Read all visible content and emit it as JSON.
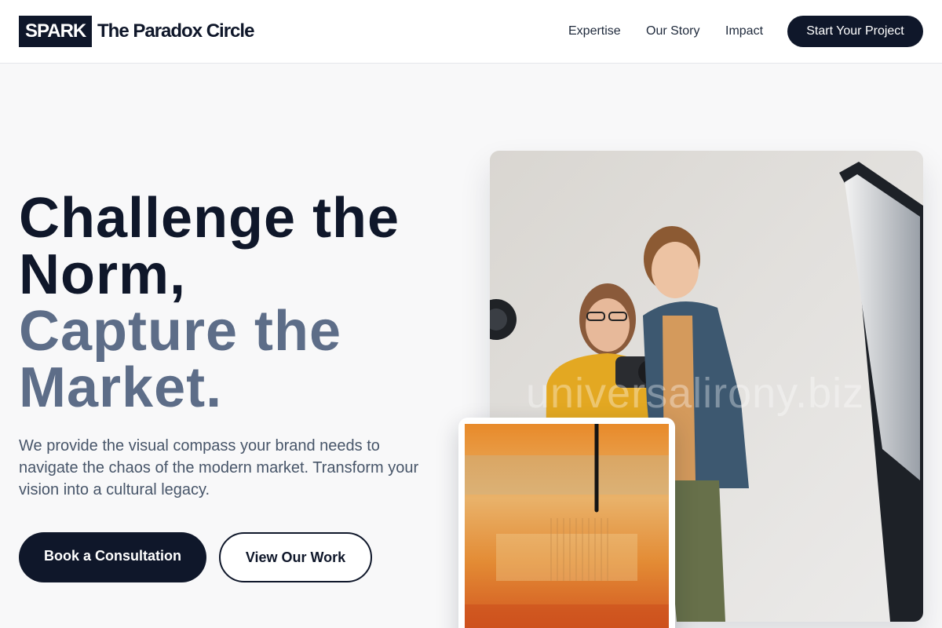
{
  "header": {
    "logo": "SPARK",
    "brand": "The Paradox Circle",
    "nav": [
      "Expertise",
      "Our Story",
      "Impact"
    ],
    "cta": "Start Your Project"
  },
  "hero": {
    "headline_line1": "Challenge the",
    "headline_line2": "Norm,",
    "headline_line3": "Capture the",
    "headline_line4": "Market.",
    "subtext": "We provide the visual compass your brand needs to navigate the chaos of the modern market. Transform your vision into a cultural legacy.",
    "primary_button": "Book a Consultation",
    "secondary_button": "View Our Work"
  },
  "photo": {
    "watermark": "universalirony.biz"
  },
  "colors": {
    "dark": "#0f172a",
    "muted_headline": "#5d6d88",
    "body_text": "#475569",
    "background": "#f8f8f9"
  }
}
